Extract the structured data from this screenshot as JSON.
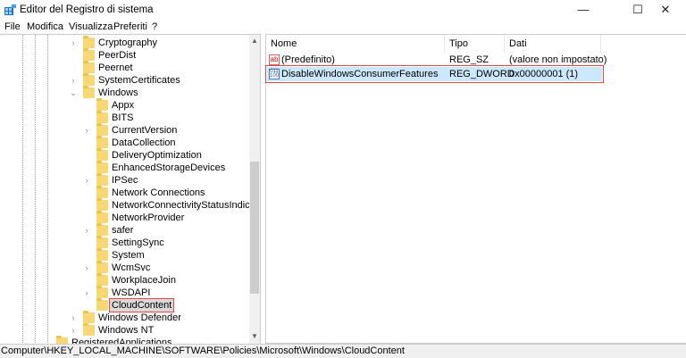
{
  "window": {
    "title": "Editor del Registro di sistema",
    "minimize": "—",
    "maximize": "☐",
    "close": "✕"
  },
  "menu": [
    "File",
    "Modifica",
    "Visualizza",
    "Preferiti",
    "?"
  ],
  "tree": [
    {
      "label": "Cryptography",
      "level": 2,
      "expander": ">"
    },
    {
      "label": "PeerDist",
      "level": 2,
      "expander": ""
    },
    {
      "label": "Peernet",
      "level": 2,
      "expander": ""
    },
    {
      "label": "SystemCertificates",
      "level": 2,
      "expander": ">"
    },
    {
      "label": "Windows",
      "level": 2,
      "expander": "v"
    },
    {
      "label": "Appx",
      "level": 3,
      "expander": ""
    },
    {
      "label": "BITS",
      "level": 3,
      "expander": ""
    },
    {
      "label": "CurrentVersion",
      "level": 3,
      "expander": ">"
    },
    {
      "label": "DataCollection",
      "level": 3,
      "expander": ""
    },
    {
      "label": "DeliveryOptimization",
      "level": 3,
      "expander": ""
    },
    {
      "label": "EnhancedStorageDevices",
      "level": 3,
      "expander": ""
    },
    {
      "label": "IPSec",
      "level": 3,
      "expander": ">"
    },
    {
      "label": "Network Connections",
      "level": 3,
      "expander": ""
    },
    {
      "label": "NetworkConnectivityStatusIndicator",
      "level": 3,
      "expander": ""
    },
    {
      "label": "NetworkProvider",
      "level": 3,
      "expander": ""
    },
    {
      "label": "safer",
      "level": 3,
      "expander": ">"
    },
    {
      "label": "SettingSync",
      "level": 3,
      "expander": ""
    },
    {
      "label": "System",
      "level": 3,
      "expander": ""
    },
    {
      "label": "WcmSvc",
      "level": 3,
      "expander": ">"
    },
    {
      "label": "WorkplaceJoin",
      "level": 3,
      "expander": ""
    },
    {
      "label": "WSDAPI",
      "level": 3,
      "expander": ">"
    },
    {
      "label": "CloudContent",
      "level": 3,
      "expander": "",
      "selected": true
    },
    {
      "label": "Windows Defender",
      "level": 2,
      "expander": ">"
    },
    {
      "label": "Windows NT",
      "level": 2,
      "expander": ">"
    },
    {
      "label": "RegisteredApplications",
      "level": 1,
      "expander": ""
    }
  ],
  "values": {
    "columns": [
      "Nome",
      "Tipo",
      "Dati"
    ],
    "rows": [
      {
        "icon": "string-value-icon",
        "name": "(Predefinito)",
        "type": "REG_SZ",
        "data": "(valore non impostato)"
      },
      {
        "icon": "dword-value-icon",
        "name": "DisableWindowsConsumerFeatures",
        "type": "REG_DWORD",
        "data": "0x00000001 (1)",
        "selected": true
      }
    ]
  },
  "status": "Computer\\HKEY_LOCAL_MACHINE\\SOFTWARE\\Policies\\Microsoft\\Windows\\CloudContent",
  "colors": {
    "selection_outline": "#e04848",
    "value_selection": "#cce8ff",
    "folder": "#f8d775"
  }
}
